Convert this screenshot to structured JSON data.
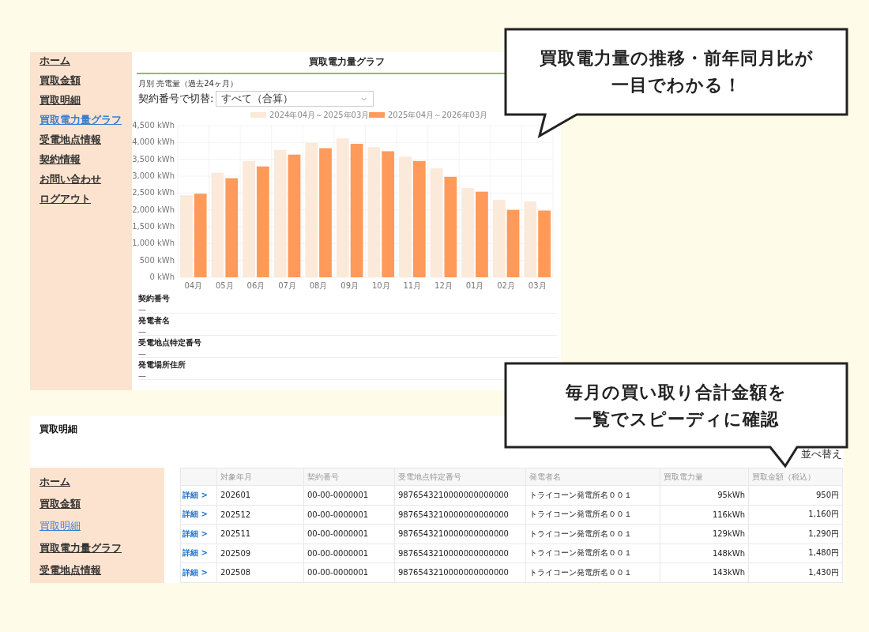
{
  "graph_screen": {
    "sidebar": [
      {
        "label": "ホーム",
        "selected": false
      },
      {
        "label": "買取金額",
        "selected": false
      },
      {
        "label": "買取明細",
        "selected": false
      },
      {
        "label": "買取電力量グラフ",
        "selected": true
      },
      {
        "label": "受電地点情報",
        "selected": false
      },
      {
        "label": "契約情報",
        "selected": false
      },
      {
        "label": "お問い合わせ",
        "selected": false
      },
      {
        "label": "ログアウト",
        "selected": false
      }
    ],
    "title": "買取電力量グラフ",
    "period_label": "月別 売電量（過去24ヶ月）",
    "switch_label": "契約番号で切替:",
    "select_value": "すべて（合算）",
    "chart_data": {
      "type": "bar",
      "categories": [
        "04月",
        "05月",
        "06月",
        "07月",
        "08月",
        "09月",
        "10月",
        "11月",
        "12月",
        "01月",
        "02月",
        "03月"
      ],
      "series": [
        {
          "name": "2024年04月～2025年03月",
          "color": "#fbe9d9",
          "values": [
            2430,
            3100,
            3450,
            3780,
            3990,
            4120,
            3860,
            3580,
            3230,
            2650,
            2300,
            2250
          ]
        },
        {
          "name": "2025年04月～2026年03月",
          "color": "#ff9a5a",
          "values": [
            2480,
            2940,
            3290,
            3640,
            3830,
            3960,
            3740,
            3450,
            2980,
            2540,
            2000,
            1980
          ]
        }
      ],
      "ylim": [
        0,
        4500
      ],
      "grid": true,
      "legend": true,
      "yticks": [
        {
          "value": 0,
          "label": "0 kWh"
        },
        {
          "value": 500,
          "label": "500 kWh"
        },
        {
          "value": 1000,
          "label": "1,000 kWh"
        },
        {
          "value": 1500,
          "label": "1,500 kWh"
        },
        {
          "value": 2000,
          "label": "2,000 kWh"
        },
        {
          "value": 2500,
          "label": "2,500 kWh"
        },
        {
          "value": 3000,
          "label": "3,000 kWh"
        },
        {
          "value": 3500,
          "label": "3,500 kWh"
        },
        {
          "value": 4000,
          "label": "4,000 kWh"
        },
        {
          "value": 4500,
          "label": "4,500 kWh"
        }
      ]
    },
    "fields": [
      {
        "label": "契約番号",
        "value": "—"
      },
      {
        "label": "発電者名",
        "value": "—"
      },
      {
        "label": "受電地点特定番号",
        "value": "—"
      },
      {
        "label": "発電場所住所",
        "value": "—"
      }
    ]
  },
  "detail_screen": {
    "title": "買取明細",
    "sort_label": "並べ替え",
    "sidebar": [
      {
        "label": "ホーム",
        "selected": false
      },
      {
        "label": "買取金額",
        "selected": false
      },
      {
        "label": "買取明細",
        "selected": true
      },
      {
        "label": "買取電力量グラフ",
        "selected": false
      },
      {
        "label": "受電地点情報",
        "selected": false
      }
    ],
    "table": {
      "columns": [
        "対象年月",
        "契約番号",
        "受電地点特定番号",
        "発電者名",
        "買取電力量",
        "買取金額（税込）"
      ],
      "rows": [
        {
          "link": "詳細 >",
          "cells": [
            "202601",
            "00-00-0000001",
            "9876543210000000000000",
            "トライコーン発電所名００１",
            "95kWh",
            "950円"
          ]
        },
        {
          "link": "詳細 >",
          "cells": [
            "202512",
            "00-00-0000001",
            "9876543210000000000000",
            "トライコーン発電所名００１",
            "116kWh",
            "1,160円"
          ]
        },
        {
          "link": "詳細 >",
          "cells": [
            "202511",
            "00-00-0000001",
            "9876543210000000000000",
            "トライコーン発電所名００１",
            "129kWh",
            "1,290円"
          ]
        },
        {
          "link": "詳細 >",
          "cells": [
            "202509",
            "00-00-0000001",
            "9876543210000000000000",
            "トライコーン発電所名００１",
            "148kWh",
            "1,480円"
          ]
        },
        {
          "link": "詳細 >",
          "cells": [
            "202508",
            "00-00-0000001",
            "9876543210000000000000",
            "トライコーン発電所名００１",
            "143kWh",
            "1,430円"
          ]
        }
      ]
    }
  },
  "callouts": [
    {
      "lines": [
        "買取電力量の推移・前年同月比が",
        "一目でわかる！"
      ]
    },
    {
      "lines": [
        "毎月の買い取り合計金額を",
        "一覧でスピーディに確認"
      ]
    }
  ]
}
